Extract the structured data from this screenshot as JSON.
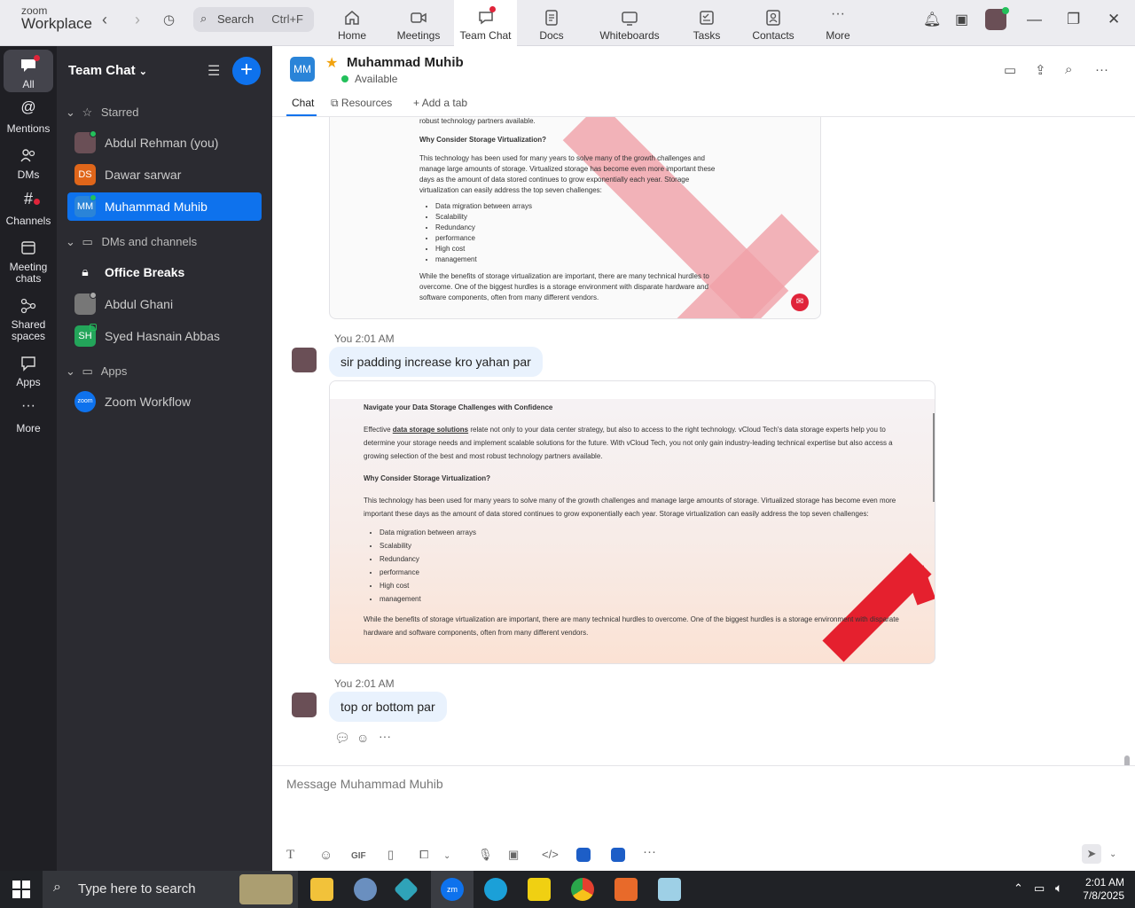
{
  "brand": {
    "top": "zoom",
    "bottom": "Workplace"
  },
  "search": {
    "label": "Search",
    "shortcut": "Ctrl+F"
  },
  "nav": [
    {
      "label": "Home"
    },
    {
      "label": "Meetings"
    },
    {
      "label": "Team Chat"
    },
    {
      "label": "Docs"
    },
    {
      "label": "Whiteboards"
    },
    {
      "label": "Tasks"
    },
    {
      "label": "Contacts"
    },
    {
      "label": "More"
    }
  ],
  "rail": [
    {
      "label": "All"
    },
    {
      "label": "Mentions"
    },
    {
      "label": "DMs"
    },
    {
      "label": "Channels"
    },
    {
      "label": "Meeting chats"
    },
    {
      "label": "Shared spaces"
    },
    {
      "label": "Apps"
    },
    {
      "label": "More"
    }
  ],
  "sidebar": {
    "title": "Team Chat",
    "starred_label": "Starred",
    "starred": [
      {
        "name": "Abdul Rehman (you)"
      },
      {
        "name": "Dawar sarwar",
        "initials": "DS"
      },
      {
        "name": "Muhammad Muhib",
        "initials": "MM"
      }
    ],
    "dms_label": "DMs and channels",
    "dms": [
      {
        "name": "Office Breaks"
      },
      {
        "name": "Abdul Ghani"
      },
      {
        "name": "Syed Hasnain Abbas",
        "initials": "SH"
      }
    ],
    "apps_label": "Apps",
    "apps": [
      {
        "name": "Zoom Workflow",
        "badge": "zoom"
      }
    ]
  },
  "chat": {
    "initials": "MM",
    "name": "Muhammad Muhib",
    "status": "Available",
    "tabs": [
      "Chat",
      "Resources",
      "Add a tab"
    ],
    "messages": [
      {
        "sender": "You 2:01 AM",
        "text": "sir padding increase kro yahan par"
      },
      {
        "sender": "You 2:01 AM",
        "text": "top or bottom par"
      }
    ],
    "composer_placeholder": "Message Muhammad Muhib"
  },
  "doc1": {
    "t0": "robust technology partners available.",
    "h2": "Why Consider Storage Virtualization?",
    "p2": "This technology has been used for many years to solve many of the growth challenges and manage large amounts of storage. Virtualized storage has become even more important these days as the amount of data stored continues to grow exponentially each year. Storage virtualization can easily  address the  top seven challenges:",
    "list": [
      "Data migration between arrays",
      "Scalability",
      "Redundancy",
      "performance",
      "High cost",
      "management"
    ],
    "p3": "While the benefits of storage virtualization are important, there are many technical hurdles to overcome. One of the biggest hurdles is a storage environment with disparate hardware and software components, often from many different vendors."
  },
  "doc2": {
    "h1": "Navigate your Data Storage Challenges with Confidence",
    "p1a": "Effective",
    "p1link": "data storage solutions",
    "p1b": "relate not only to your data center strategy, but also to access to the right technology. vCloud Tech's data storage experts help you to determine your storage needs and implement scalable solutions for the future. With vCloud Tech, you not only gain industry-leading technical expertise but also access a growing selection of the best and most robust technology partners available.",
    "h2": "Why Consider Storage Virtualization?",
    "p2": "This technology has been used for many years to solve many of the growth challenges and manage large amounts of storage. Virtualized storage has become even more important these days as the amount of data stored continues to grow exponentially each year. Storage virtualization can easily  address the  top seven challenges:",
    "list": [
      "Data migration between arrays",
      "Scalability",
      "Redundancy",
      "performance",
      "High cost",
      "management"
    ],
    "p3": "While the benefits of storage virtualization are important, there are many technical hurdles to overcome. One of the biggest hurdles is a storage environment with disparate hardware and software components, often from many different vendors."
  },
  "taskbar": {
    "search": "Type here to search",
    "time": "2:01 AM",
    "date": "7/8/2025"
  },
  "colors": {
    "accent": "#0e72ed",
    "rail": "#1f1f24",
    "sidebar": "#2b2b31",
    "bubble": "#e9f2fd",
    "online": "#23c05b",
    "alert": "#e0243a"
  }
}
